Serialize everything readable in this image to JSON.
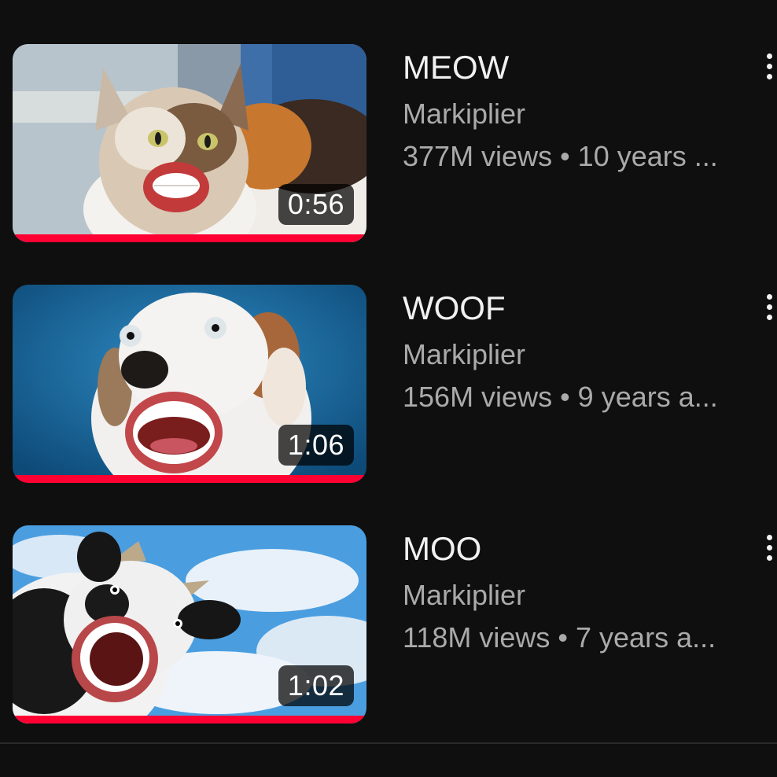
{
  "videos": [
    {
      "title": "MEOW",
      "channel": "Markiplier",
      "stats": "377M views • 10 years ...",
      "duration": "0:56",
      "watched_fraction": 1.0,
      "thumbnail": "cat-with-human-mouth-thumbnail"
    },
    {
      "title": "WOOF",
      "channel": "Markiplier",
      "stats": "156M views • 9 years a...",
      "duration": "1:06",
      "watched_fraction": 1.0,
      "thumbnail": "dog-with-human-mouth-thumbnail"
    },
    {
      "title": "MOO",
      "channel": "Markiplier",
      "stats": "118M views • 7 years a...",
      "duration": "1:02",
      "watched_fraction": 1.0,
      "thumbnail": "cow-with-human-mouth-thumbnail"
    }
  ],
  "colors": {
    "background": "#0f0f0f",
    "progress": "#ff0033",
    "title": "#f1f1f1",
    "secondary": "#aaaaaa"
  },
  "icons": {
    "menu": "more-vertical-icon"
  }
}
